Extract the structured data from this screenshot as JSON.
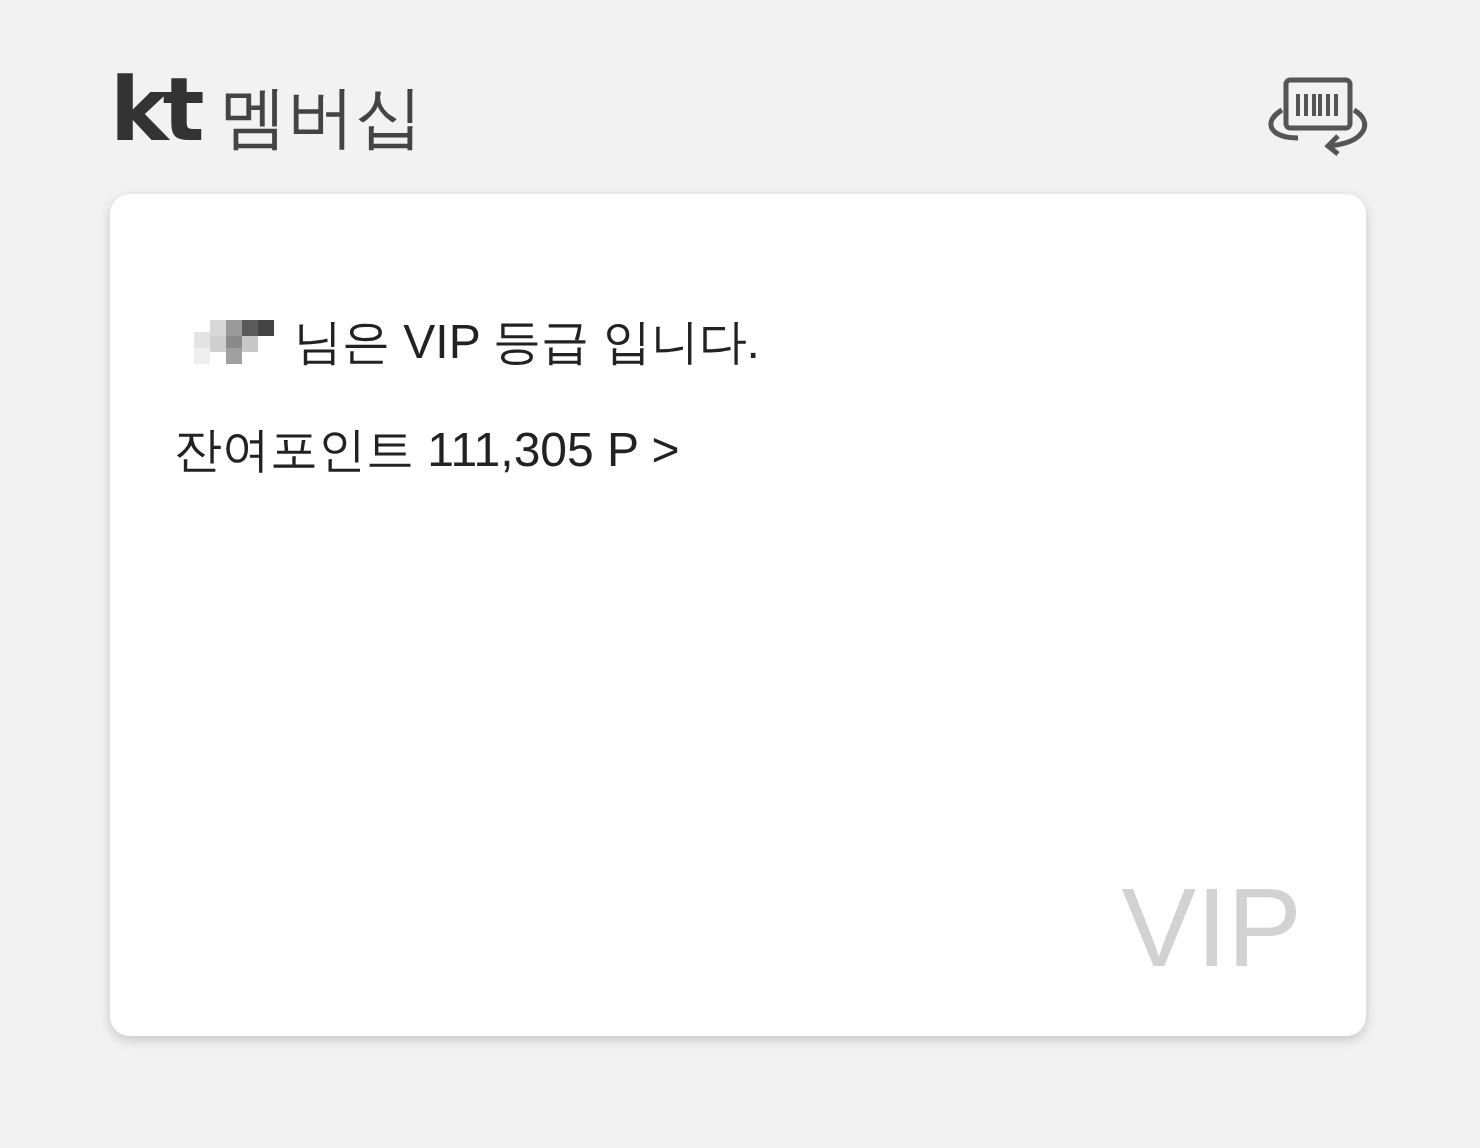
{
  "header": {
    "logo": "kt",
    "title": "멤버십"
  },
  "card": {
    "greeting": "님은 VIP 등급 입니다.",
    "points": "잔여포인트 111,305 P >",
    "grade": "VIP"
  }
}
